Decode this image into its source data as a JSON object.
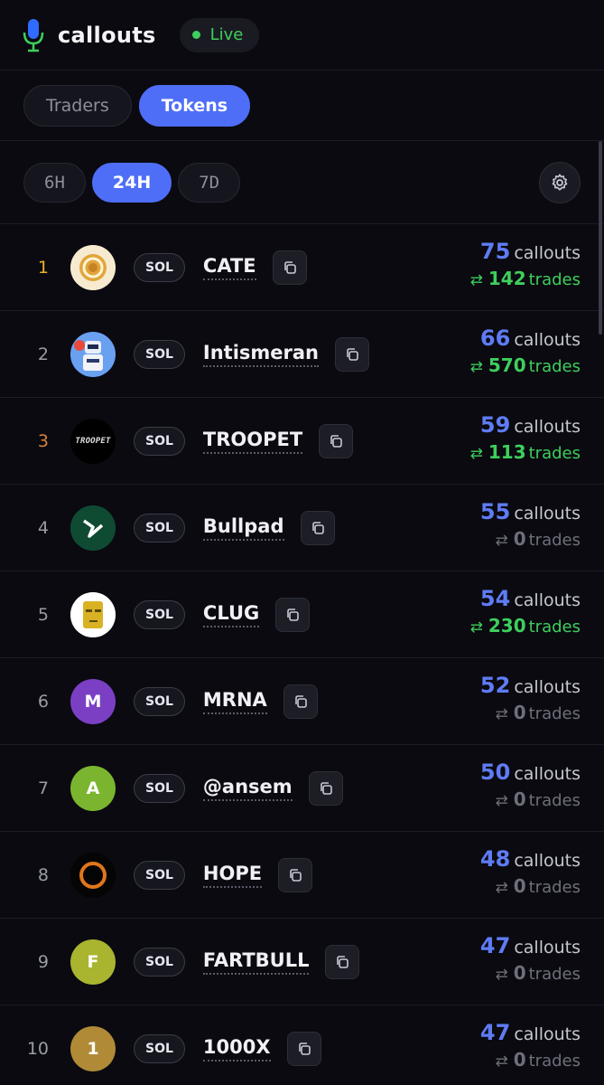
{
  "header": {
    "brand": "callouts",
    "status": "Live",
    "mic_icon": "microphone-icon"
  },
  "tabs": [
    {
      "label": "Traders",
      "active": false
    },
    {
      "label": "Tokens",
      "active": true
    }
  ],
  "time_filters": [
    {
      "label": "6H",
      "active": false
    },
    {
      "label": "24H",
      "active": true
    },
    {
      "label": "7D",
      "active": false
    }
  ],
  "settings_icon": "gear-icon",
  "rows": [
    {
      "rank": "1",
      "chain": "SOL",
      "name": "CATE",
      "callouts": "75",
      "callouts_label": "callouts",
      "trades": "142",
      "trades_label": "trades",
      "avatar_text": "",
      "avatar_color": "#f3e3b8",
      "rank_color": "gold",
      "trades_positive": true
    },
    {
      "rank": "2",
      "chain": "SOL",
      "name": "Intismeran",
      "callouts": "66",
      "callouts_label": "callouts",
      "trades": "570",
      "trades_label": "trades",
      "avatar_text": "",
      "avatar_color": "#3b6fd9",
      "rank_color": "",
      "trades_positive": true
    },
    {
      "rank": "3",
      "chain": "SOL",
      "name": "TROOPET",
      "callouts": "59",
      "callouts_label": "callouts",
      "trades": "113",
      "trades_label": "trades",
      "avatar_text": "TROOPET",
      "avatar_color": "#000000",
      "rank_color": "bronze",
      "trades_positive": true
    },
    {
      "rank": "4",
      "chain": "SOL",
      "name": "Bullpad",
      "callouts": "55",
      "callouts_label": "callouts",
      "trades": "0",
      "trades_label": "trades",
      "avatar_text": "",
      "avatar_color": "#0f4a33",
      "rank_color": "",
      "trades_positive": false
    },
    {
      "rank": "5",
      "chain": "SOL",
      "name": "CLUG",
      "callouts": "54",
      "callouts_label": "callouts",
      "trades": "230",
      "trades_label": "trades",
      "avatar_text": "",
      "avatar_color": "#ffffff",
      "rank_color": "",
      "trades_positive": true
    },
    {
      "rank": "6",
      "chain": "SOL",
      "name": "MRNA",
      "callouts": "52",
      "callouts_label": "callouts",
      "trades": "0",
      "trades_label": "trades",
      "avatar_text": "M",
      "avatar_color": "#7b3fc4",
      "rank_color": "",
      "trades_positive": false
    },
    {
      "rank": "7",
      "chain": "SOL",
      "name": "@ansem",
      "callouts": "50",
      "callouts_label": "callouts",
      "trades": "0",
      "trades_label": "trades",
      "avatar_text": "A",
      "avatar_color": "#7bb52f",
      "rank_color": "",
      "trades_positive": false
    },
    {
      "rank": "8",
      "chain": "SOL",
      "name": "HOPE",
      "callouts": "48",
      "callouts_label": "callouts",
      "trades": "0",
      "trades_label": "trades",
      "avatar_text": "",
      "avatar_color": "#050505",
      "rank_color": "",
      "trades_positive": false
    },
    {
      "rank": "9",
      "chain": "SOL",
      "name": "FARTBULL",
      "callouts": "47",
      "callouts_label": "callouts",
      "trades": "0",
      "trades_label": "trades",
      "avatar_text": "F",
      "avatar_color": "#a9b52f",
      "rank_color": "",
      "trades_positive": false
    },
    {
      "rank": "10",
      "chain": "SOL",
      "name": "1000X",
      "callouts": "47",
      "callouts_label": "callouts",
      "trades": "0",
      "trades_label": "trades",
      "avatar_text": "1",
      "avatar_color": "#b08a36",
      "rank_color": "",
      "trades_positive": false
    }
  ]
}
